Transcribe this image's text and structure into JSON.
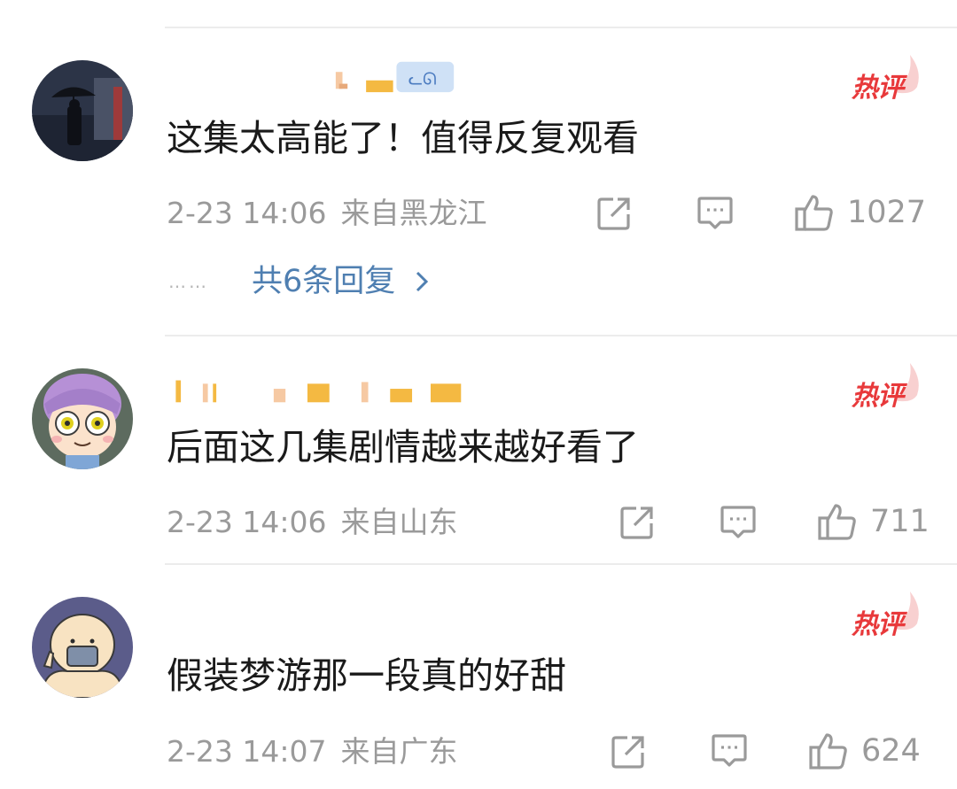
{
  "colors": {
    "hot_badge": "#e8393b",
    "reply_link": "#4f7fb1",
    "meta_text": "#9a9a9a",
    "comment_text": "#1a1a1a",
    "divider": "#ececec"
  },
  "comments": [
    {
      "hot_badge": "热评",
      "text": "这集太高能了！值得反复观看",
      "time": "2-23 14:06",
      "location": "来自黑龙江",
      "likes": "1027",
      "replies_label": "共6条回复",
      "replies_dots": "……"
    },
    {
      "hot_badge": "热评",
      "text": "后面这几集剧情越来越好看了",
      "time": "2-23 14:06",
      "location": "来自山东",
      "likes": "711"
    },
    {
      "hot_badge": "热评",
      "text": "假装梦游那一段真的好甜",
      "time": "2-23 14:07",
      "location": "来自广东",
      "likes": "624"
    }
  ],
  "icons": {
    "share": "share-icon",
    "comment": "comment-icon",
    "like": "thumbs-up-icon",
    "chevron": "chevron-right-icon",
    "hot": "flame-icon"
  }
}
